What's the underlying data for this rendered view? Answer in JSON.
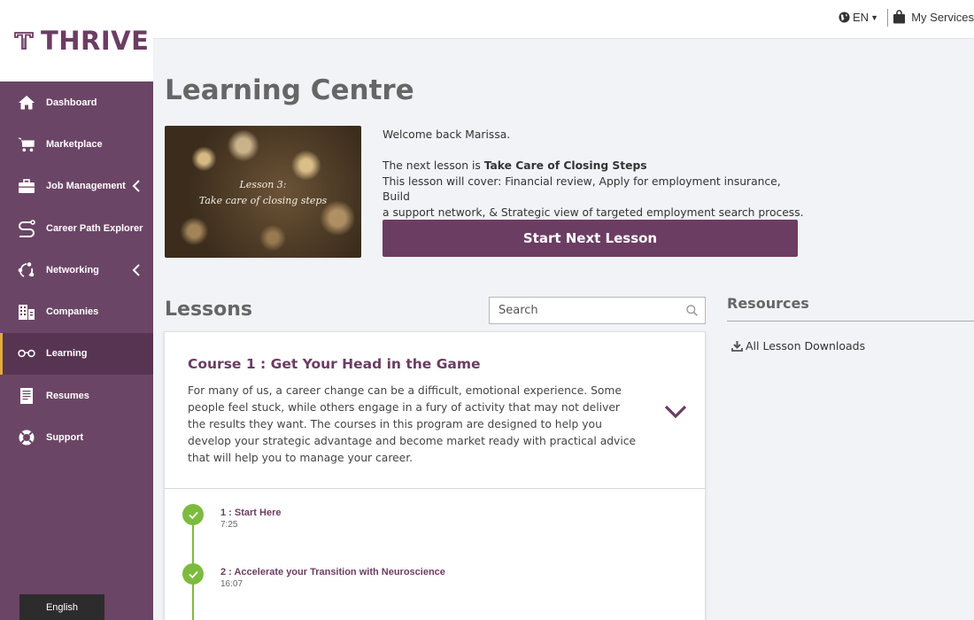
{
  "brand": {
    "name": "THRIVE",
    "color": "#6b3d63"
  },
  "sidebar": {
    "items": [
      {
        "label": "Dashboard",
        "icon": "home-icon"
      },
      {
        "label": "Marketplace",
        "icon": "cart-icon"
      },
      {
        "label": "Job Management",
        "icon": "briefcase-icon",
        "has_chevron": true
      },
      {
        "label": "Career Path Explorer",
        "icon": "path-icon"
      },
      {
        "label": "Networking",
        "icon": "network-icon",
        "has_chevron": true
      },
      {
        "label": "Companies",
        "icon": "building-icon"
      },
      {
        "label": "Learning",
        "icon": "glasses-icon",
        "active": true
      },
      {
        "label": "Resumes",
        "icon": "document-icon"
      },
      {
        "label": "Support",
        "icon": "lifebuoy-icon"
      }
    ],
    "language_button": "English",
    "colors": {
      "background": "#6b4566",
      "active": "#573552",
      "active_marker": "#e5a93a"
    }
  },
  "topbar": {
    "language": "EN",
    "services_label": "My Services"
  },
  "main": {
    "title": "Learning Centre",
    "thumbnail": {
      "line1": "Lesson 3:",
      "line2": "Take care of closing steps"
    },
    "welcome": {
      "greeting": "Welcome back Marissa.",
      "next_prefix": "The next lesson is ",
      "next_lesson": "Take Care of Closing Steps",
      "cover_line1": "This lesson will cover: Financial review, Apply for employment insurance, Build",
      "cover_line2": "a support network, & Strategic view of targeted employment search process."
    },
    "start_button": "Start Next Lesson",
    "lessons_title": "Lessons",
    "search_placeholder": "Search",
    "course": {
      "title": "Course 1 : Get Your Head in the Game",
      "description": "For many of us, a career change can be a difficult, emotional experience. Some people feel stuck, while others engage in a fury of activity that may not deliver the results they want. The courses in this program are designed to help you develop your strategic advantage and become market ready with practical advice that will help you to manage your career.",
      "lessons": [
        {
          "title": "1 : Start Here",
          "duration": "7:25",
          "completed": true
        },
        {
          "title": "2 : Accelerate your Transition with Neuroscience",
          "duration": "16:07",
          "completed": true
        }
      ]
    }
  },
  "resources": {
    "title": "Resources",
    "links": [
      {
        "label": "All Lesson Downloads",
        "icon": "download-icon"
      }
    ]
  },
  "colors": {
    "accent": "#6b3d63",
    "success": "#7dbb3f",
    "page_bg": "#f2f3f7"
  }
}
